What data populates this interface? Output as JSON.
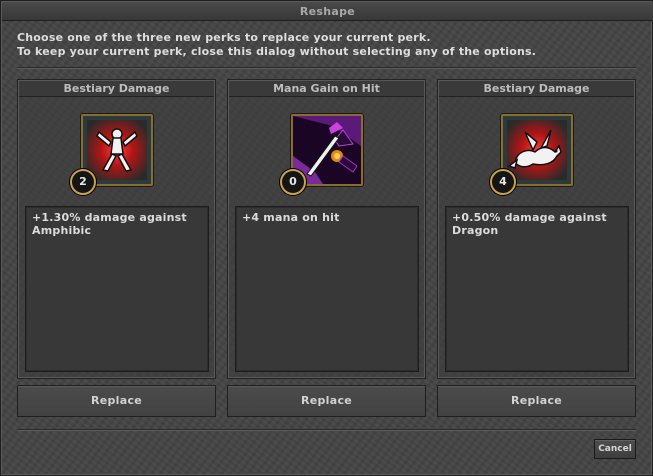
{
  "window": {
    "title": "Reshape"
  },
  "intro": {
    "line1": "Choose one of the three new perks to replace your current perk.",
    "line2": "To keep your current perk, close this dialog without selecting any of the options."
  },
  "perks": [
    {
      "title": "Bestiary Damage",
      "icon": "bestiary-amphibic-icon",
      "level": "2",
      "description": "+1.30% damage against Amphibic",
      "button": "Replace"
    },
    {
      "title": "Mana Gain on Hit",
      "icon": "mana-gain-icon",
      "level": "0",
      "description": "+4 mana on hit",
      "button": "Replace"
    },
    {
      "title": "Bestiary Damage",
      "icon": "bestiary-dragon-icon",
      "level": "4",
      "description": "+0.50% damage against Dragon",
      "button": "Replace"
    }
  ],
  "footer": {
    "cancel_label": "Cancel"
  },
  "colors": {
    "frame_gold": "#c9a24b",
    "background": "#444444",
    "text": "#dcdcdc"
  }
}
